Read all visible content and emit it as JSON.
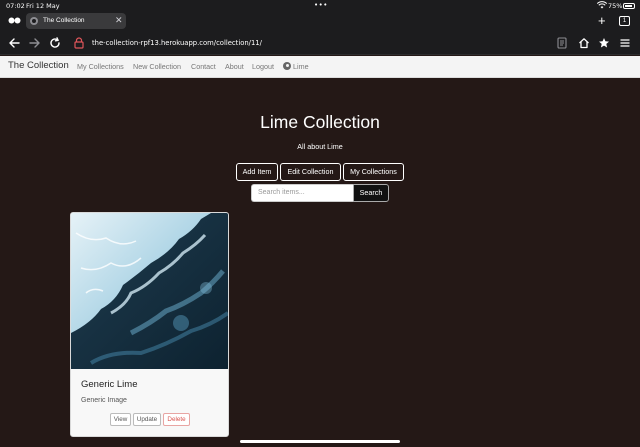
{
  "status_bar": {
    "time": "07:02",
    "date": "Fri 12 May",
    "more_dots": "•••",
    "battery_pct": "75%"
  },
  "browser": {
    "tab": {
      "title": "The Collection",
      "close": "✕"
    },
    "new_tab": "+",
    "tab_count": "1",
    "url": "the-collection-rpf13.herokuapp.com/collection/11/"
  },
  "site_nav": {
    "brand": "The Collection",
    "links": [
      "My Collections",
      "New Collection",
      "Contact",
      "About",
      "Logout"
    ],
    "user": "Lime"
  },
  "main": {
    "title": "Lime Collection",
    "subtitle": "All about Lime",
    "buttons": {
      "add": "Add Item",
      "edit": "Edit Collection",
      "mine": "My Collections"
    },
    "search": {
      "placeholder": "Search items...",
      "button": "Search"
    }
  },
  "items": [
    {
      "title": "Generic Lime",
      "text": "Generic Image",
      "buttons": {
        "view": "View",
        "update": "Update",
        "delete": "Delete"
      }
    }
  ],
  "colors": {
    "page_background": "#241816",
    "browser_chrome": "#1c1c1e",
    "navbar_background": "#f4f4f4",
    "delete_red": "#d9534f"
  },
  "icons": [
    "back-arrow-icon",
    "forward-arrow-icon",
    "reload-icon",
    "lock-icon",
    "reader-icon",
    "home-icon",
    "bookmark-star-icon",
    "menu-icon",
    "user-icon",
    "wifi-icon",
    "battery-icon"
  ]
}
